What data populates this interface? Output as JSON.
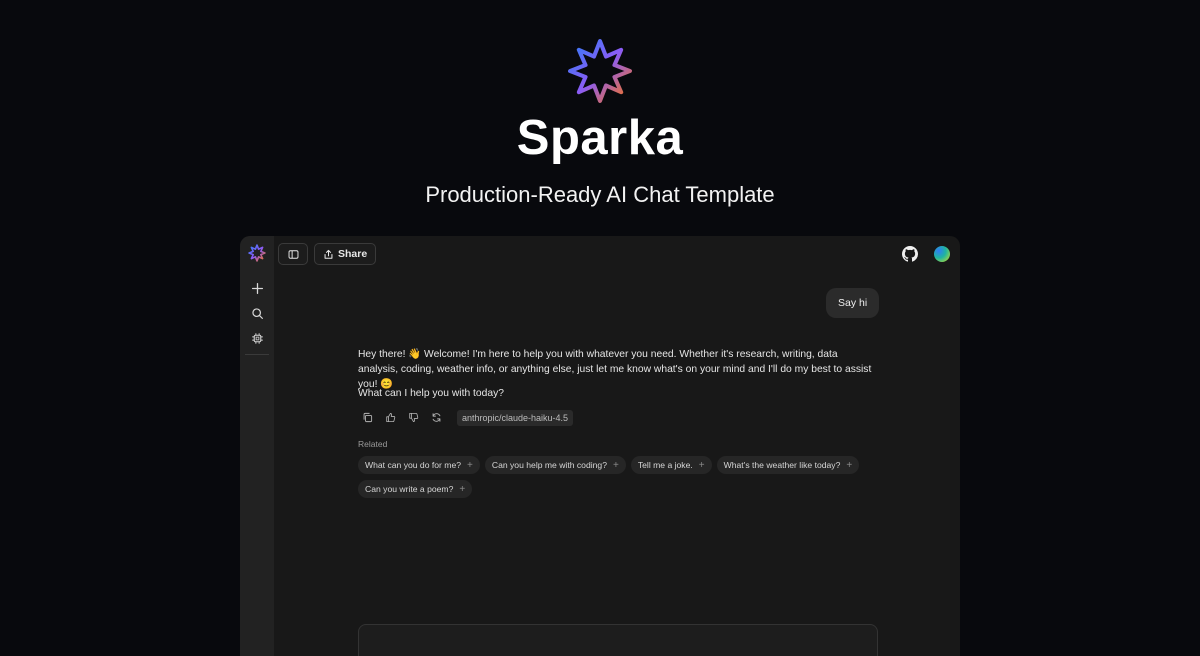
{
  "hero": {
    "title": "Sparka",
    "tagline": "Production-Ready AI Chat Template",
    "logo_icon": "sparka-star-icon",
    "logo_gradient": [
      "#2f7cf6",
      "#8b5cf6",
      "#f97316"
    ]
  },
  "app": {
    "sidebar": {
      "items": [
        {
          "icon": "plus-icon",
          "name": "new-chat"
        },
        {
          "icon": "search-icon",
          "name": "search"
        },
        {
          "icon": "cpu-icon",
          "name": "models"
        }
      ]
    },
    "topbar": {
      "toggle_icon": "sidebar-toggle-icon",
      "share_label": "Share",
      "github_icon": "github-icon",
      "avatar_icon": "avatar"
    },
    "conversation": {
      "user_message": "Say hi",
      "assistant_message": "Hey there! 👋 Welcome! I'm here to help you with whatever you need. Whether it's research, writing, data analysis, coding, weather info, or anything else, just let me know what's on your mind and I'll do my best to assist you! 😊",
      "assistant_question": "What can I help you with today?",
      "model": "anthropic/claude-haiku-4.5",
      "actions": [
        "copy-icon",
        "thumbs-up-icon",
        "thumbs-down-icon",
        "refresh-icon"
      ]
    },
    "related": {
      "label": "Related",
      "suggestions": [
        "What can you do for me?",
        "Can you help me with coding?",
        "Tell me a joke.",
        "What's the weather like today?",
        "Can you write a poem?"
      ]
    }
  },
  "colors": {
    "page_bg": "#08090d",
    "window_bg": "#181818",
    "sidebar_bg": "#222222"
  }
}
